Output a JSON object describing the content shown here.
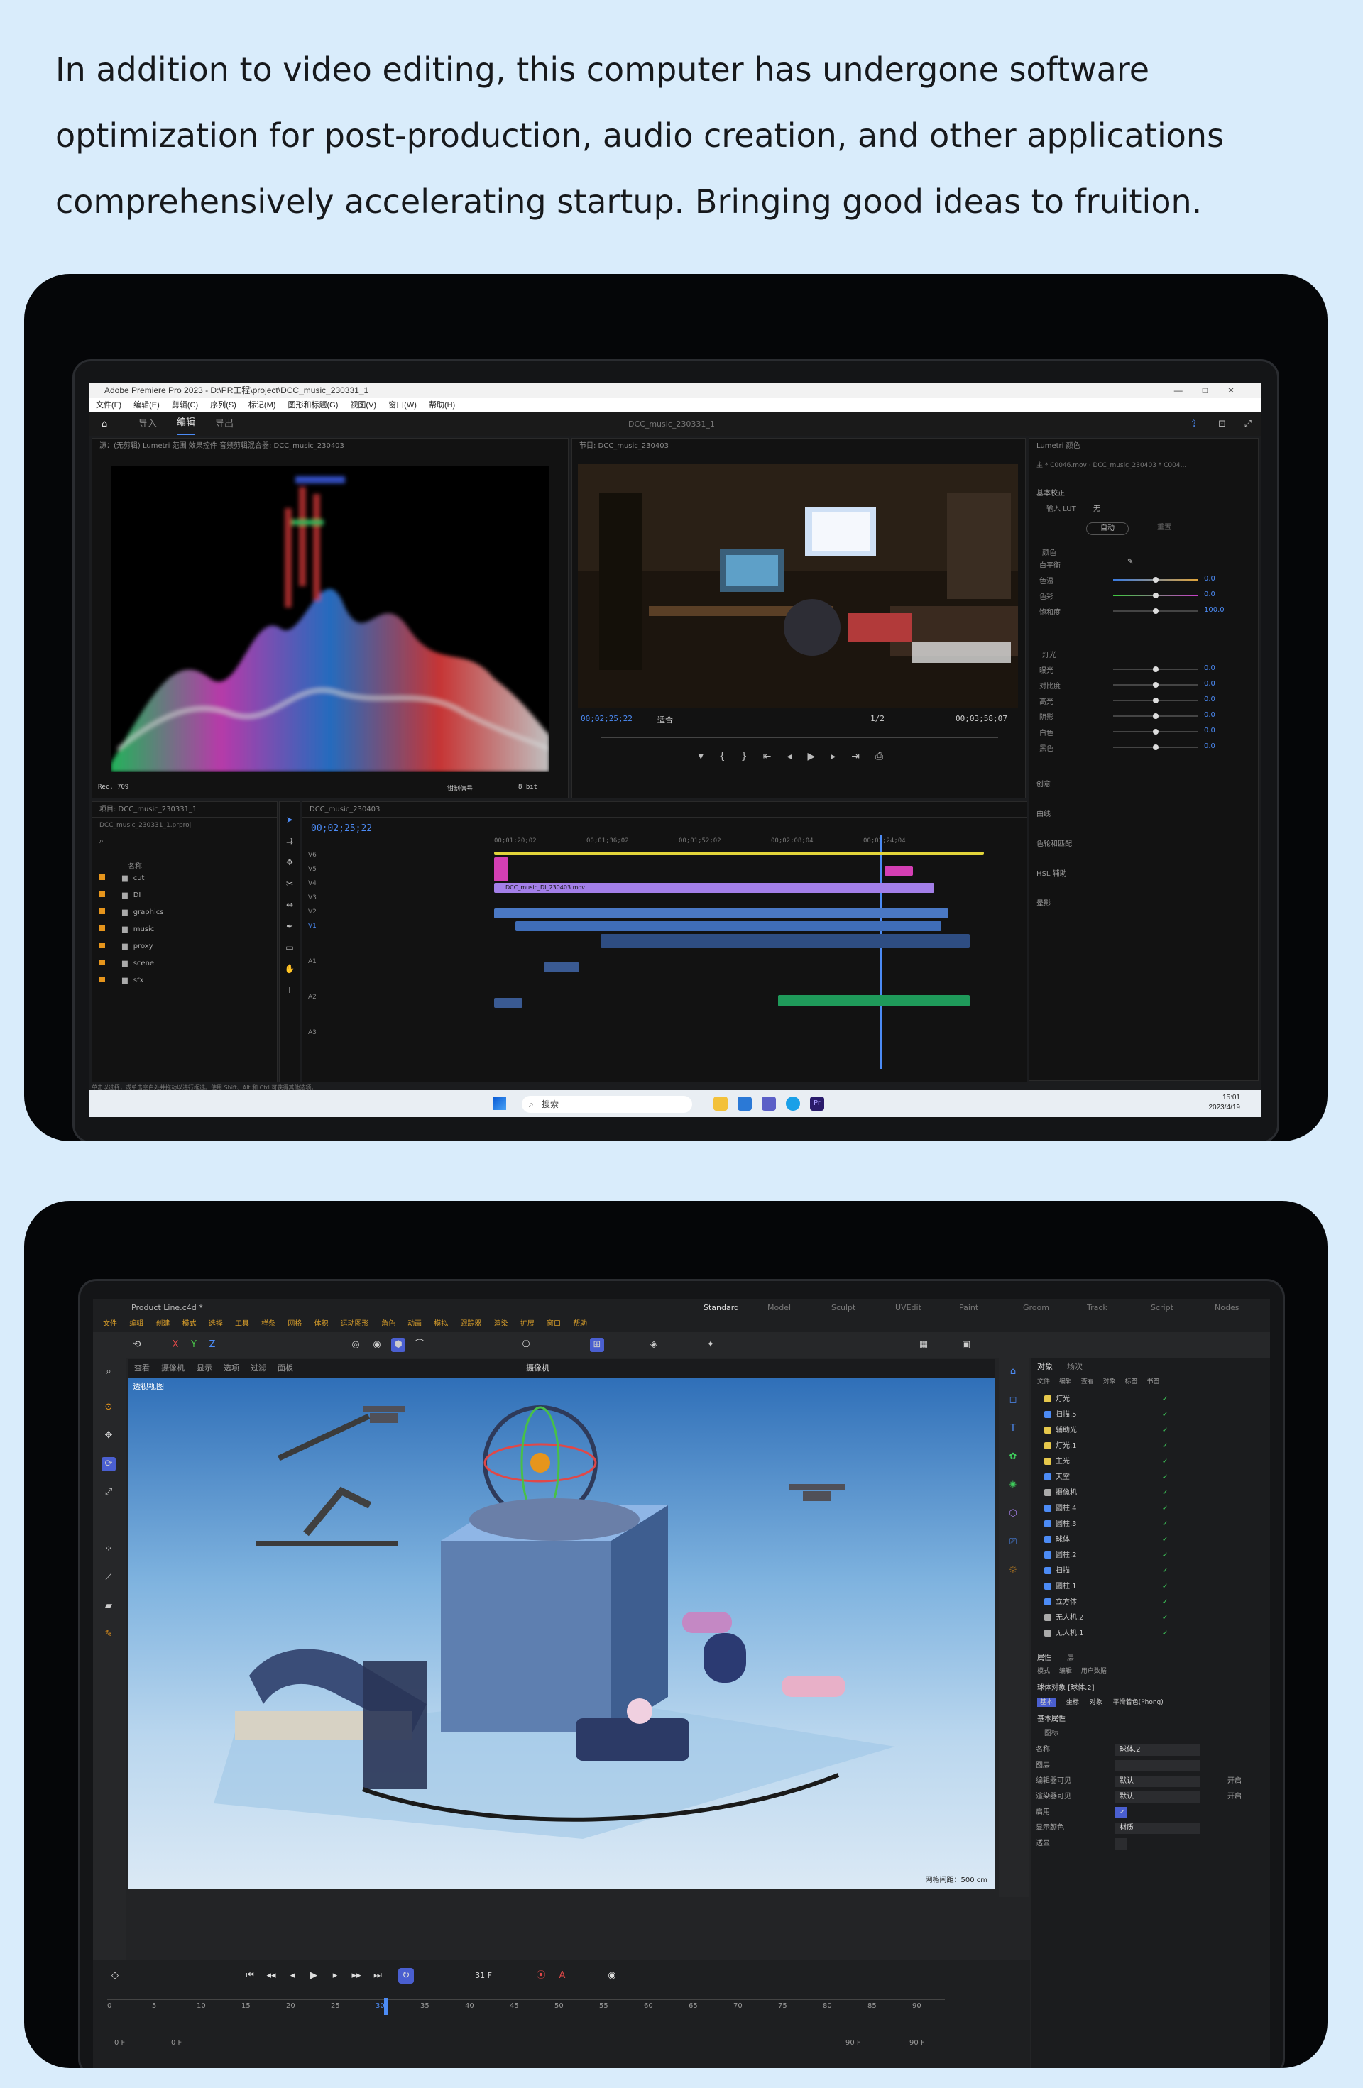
{
  "intro": {
    "line1": "In addition to video editing, this computer has undergone software",
    "line2": "optimization for post-production, audio creation, and other applications",
    "line3": "comprehensively accelerating startup. Bringing good ideas to fruition."
  },
  "premiere": {
    "window_title": "Adobe Premiere Pro 2023 - D:\\PR工程\\project\\DCC_music_230331_1",
    "window_controls": [
      "—",
      "□",
      "✕"
    ],
    "menu": [
      "文件(F)",
      "编辑(E)",
      "剪辑(C)",
      "序列(S)",
      "标记(M)",
      "图形和标题(G)",
      "视图(V)",
      "窗口(W)",
      "帮助(H)"
    ],
    "workspace_tabs": [
      "导入",
      "编辑",
      "导出"
    ],
    "workspace_title": "DCC_music_230331_1",
    "source_tabs": "源：(无剪辑)    Lumetri 范围    效果控件    音频剪辑混合器: DCC_music_230403",
    "program_tab": "节目: DCC_music_230403",
    "program_tc_left": "00;02;25;22",
    "program_fit": "适合",
    "program_ratio": "1/2",
    "program_tc_right": "00;03;58;07",
    "scope_footer": "Rec. 709",
    "scope_signal": "钳制信号",
    "scope_bits": "8 bit",
    "lumetri": {
      "tab": "Lumetri 颜色",
      "clip": "主 * C0046.mov  ·  DCC_music_230403 * C004...",
      "section_basic": "基本校正",
      "input_lut_label": "输入 LUT",
      "input_lut_value": "无",
      "auto_button": "自动",
      "reset_button": "重置",
      "section_color": "颜色",
      "section_light": "灯光",
      "rows": [
        {
          "label": "白平衡",
          "value": ""
        },
        {
          "label": "色温",
          "value": "0.0"
        },
        {
          "label": "色彩",
          "value": "0.0"
        },
        {
          "label": "饱和度",
          "value": "100.0"
        },
        {
          "label": "曝光",
          "value": "0.0"
        },
        {
          "label": "对比度",
          "value": "0.0"
        },
        {
          "label": "高光",
          "value": "0.0"
        },
        {
          "label": "阴影",
          "value": "0.0"
        },
        {
          "label": "白色",
          "value": "0.0"
        },
        {
          "label": "黑色",
          "value": "0.0"
        }
      ],
      "sections": [
        "创意",
        "曲线",
        "色轮和匹配",
        "HSL 辅助",
        "晕影"
      ]
    },
    "project": {
      "tab": "项目: DCC_music_230331_1",
      "file": "DCC_music_230331_1.prproj",
      "col_name": "名称",
      "bins": [
        "cut",
        "DI",
        "graphics",
        "music",
        "proxy",
        "scene",
        "sfx"
      ]
    },
    "timeline": {
      "tab": "DCC_music_230403",
      "timecode": "00;02;25;22",
      "ruler": [
        "00;01;20;02",
        "00;01;36;02",
        "00;01;52;02",
        "00;02;08;04",
        "00;02;24;04"
      ],
      "title_clip": "DCC_music_DI_230403.mov",
      "tracks_video": [
        "V6",
        "V5",
        "V4",
        "V3",
        "V2",
        "V1"
      ],
      "tracks_audio": [
        "A1",
        "A2",
        "A3"
      ]
    },
    "statusbar": "单击以选择，或单击空白处并拖动以进行框选。使用 Shift、Alt 和 Ctrl 可获得其他选项。",
    "taskbar": {
      "search": "搜索",
      "time": "15:01",
      "date": "2023/4/19"
    }
  },
  "c4d": {
    "file_tab": "Product Line.c4d *",
    "layouts": [
      "Standard",
      "Model",
      "Sculpt",
      "UVEdit",
      "Paint",
      "Groom",
      "Track",
      "Script",
      "Nodes"
    ],
    "menu": [
      "文件",
      "编辑",
      "创建",
      "模式",
      "选择",
      "工具",
      "样条",
      "网格",
      "体积",
      "运动图形",
      "角色",
      "动画",
      "模拟",
      "跟踪器",
      "渲染",
      "扩展",
      "窗口",
      "帮助"
    ],
    "axis_labels": [
      "X",
      "Y",
      "Z"
    ],
    "view_menu": [
      "查看",
      "摄像机",
      "显示",
      "选项",
      "过滤",
      "面板"
    ],
    "viewport_label": "透视视图",
    "camera_label": "摄像机",
    "grid_label": "网格间距：500 cm",
    "objmgr_tabs": [
      "对象",
      "场次"
    ],
    "objmgr_menu": [
      "文件",
      "编辑",
      "查看",
      "对象",
      "标签",
      "书签"
    ],
    "objects": [
      "灯光",
      "扫描.5",
      "辅助光",
      "灯光.1",
      "主光",
      "天空",
      "摄像机",
      "圆柱.4",
      "圆柱.3",
      "球体",
      "圆柱.2",
      "扫描",
      "圆柱.1",
      "立方体",
      "无人机.2",
      "无人机.1"
    ],
    "attr_tabs": [
      "属性",
      "层"
    ],
    "attr_menu": [
      "模式",
      "编辑",
      "用户数据"
    ],
    "attr_object": "球体对象 [球体.2]",
    "attr_subtabs": [
      "基本",
      "坐标",
      "对象",
      "平滑着色(Phong)"
    ],
    "attr_section": "基本属性",
    "attr_sub": "图标",
    "attr_rows": [
      {
        "label": "名称",
        "value": "球体.2"
      },
      {
        "label": "图层",
        "value": ""
      },
      {
        "label": "编辑器可见",
        "value": "默认"
      },
      {
        "label": "渲染器可见",
        "value": "默认"
      },
      {
        "label": "启用",
        "value": "✓"
      },
      {
        "label": "显示颜色",
        "value": "材质"
      },
      {
        "label": "透显",
        "value": ""
      }
    ],
    "attr_right": [
      "开启",
      "开启"
    ],
    "timeline": {
      "frame": "31 F",
      "ruler": [
        "0",
        "5",
        "10",
        "15",
        "20",
        "25",
        "30",
        "35",
        "40",
        "45",
        "50",
        "55",
        "60",
        "65",
        "70",
        "75",
        "80",
        "85",
        "90"
      ],
      "start": "0 F",
      "start2": "0 F",
      "end": "90 F",
      "end2": "90 F"
    }
  }
}
